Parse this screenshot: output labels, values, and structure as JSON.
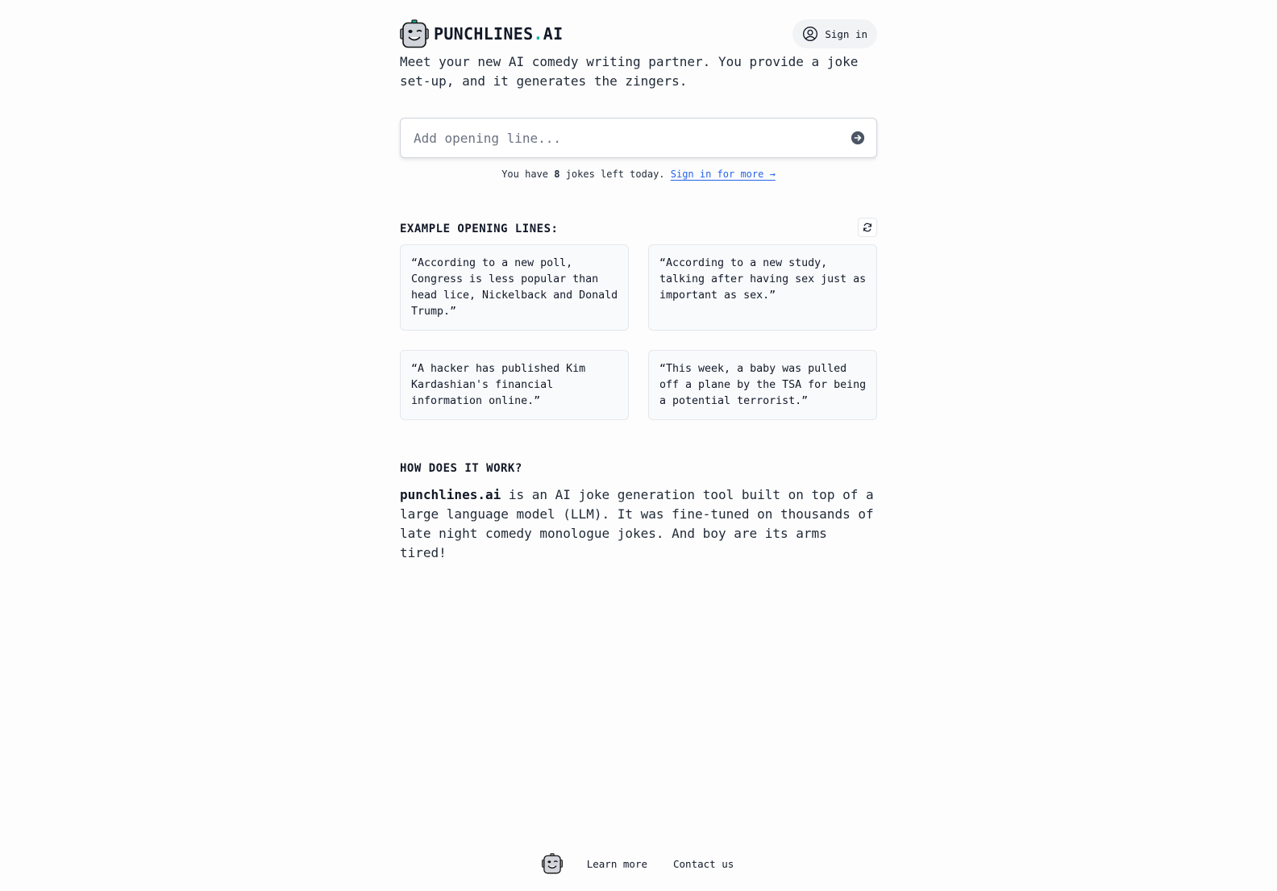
{
  "header": {
    "brand_name": "PUNCHLINES",
    "brand_dot": ".",
    "brand_tld": "AI",
    "sign_in_label": "Sign in",
    "tagline": "Meet your new AI comedy writing partner. You provide a joke set-up, and it generates the zingers."
  },
  "prompt": {
    "placeholder": "Add opening line...",
    "value": ""
  },
  "quota": {
    "prefix": "You have ",
    "count": "8",
    "suffix": " jokes left today. ",
    "link_label": "Sign in for more →"
  },
  "examples": {
    "title": "EXAMPLE OPENING LINES:",
    "items": [
      {
        "text": "“According to a new poll, Congress is less popular than head lice, Nickelback and Donald Trump.”"
      },
      {
        "text": "“According to a new study, talking after having sex just as important as sex.”"
      },
      {
        "text": "“A hacker has published Kim Kardashian's financial information online.”"
      },
      {
        "text": "“This week, a baby was pulled off a plane by the TSA for being a potential terrorist.”"
      }
    ]
  },
  "how_it_works": {
    "title": "HOW DOES IT WORK?",
    "brand": "punchlines.ai",
    "body": " is an AI joke generation tool built on top of a large language model (LLM). It was fine-tuned on thousands of late night comedy monologue jokes. And boy are its arms tired!"
  },
  "footer": {
    "links": [
      {
        "label": "Learn more"
      },
      {
        "label": "Contact us"
      }
    ]
  },
  "colors": {
    "accent_dot": "#14b8a6",
    "link": "#2563eb",
    "submit_icon": "#4b5563",
    "card_bg": "#f8fafc"
  }
}
